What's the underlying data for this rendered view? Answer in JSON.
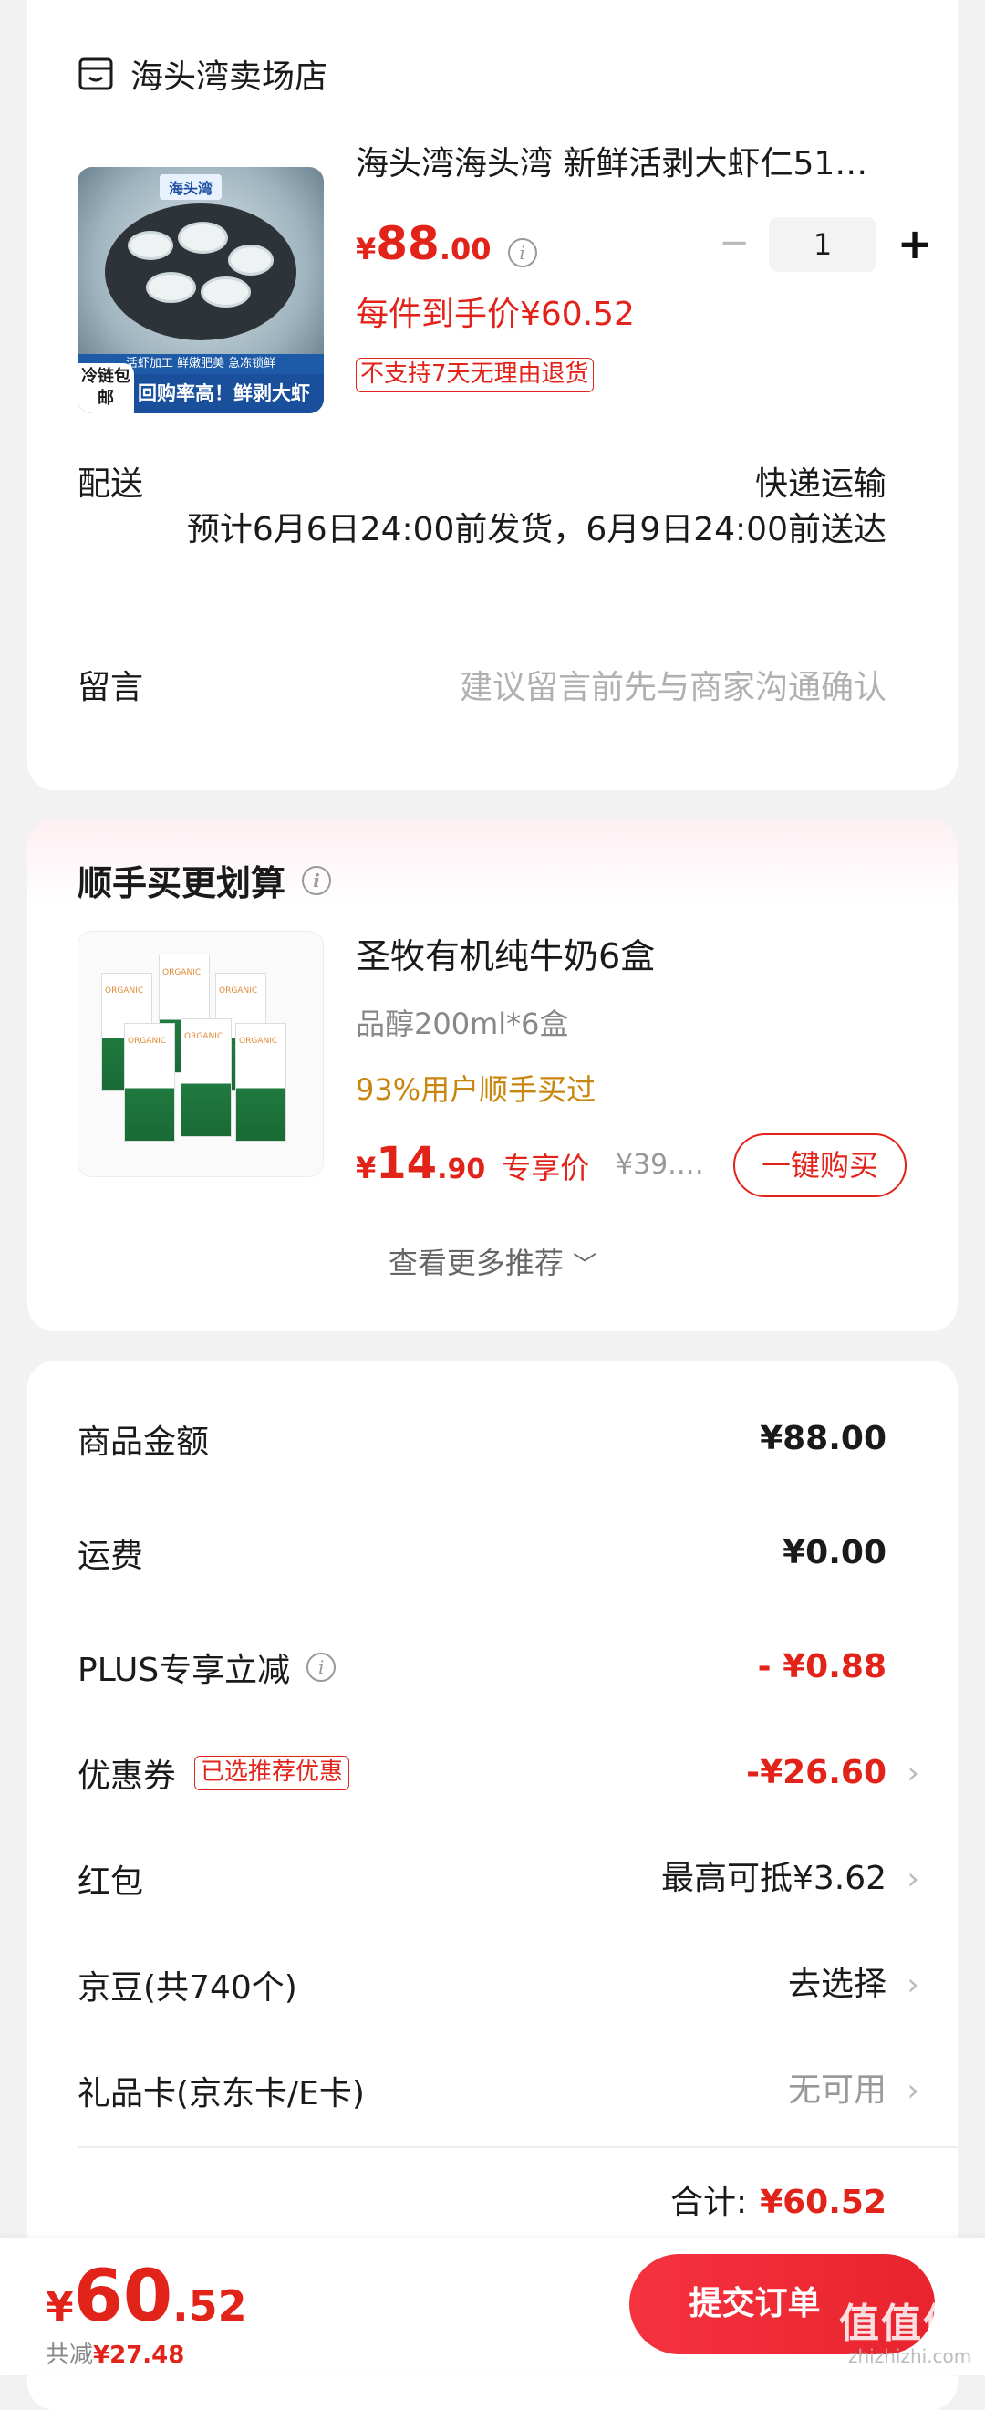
{
  "store": {
    "name": "海头湾卖场店",
    "icon": "store-icon",
    "product": {
      "title": "海头湾海头湾 新鲜活剥大虾仁51…",
      "image_badges": {
        "brand": "海头湾",
        "cold_chain": "冷链包邮",
        "strip_top": "活虾加工 鲜嫩肥美 急冻锁鲜",
        "strip_bottom": "回购率高！鲜剥大虾仁"
      },
      "price_symbol": "¥",
      "price_int": "88",
      "price_dec": ".00",
      "quantity": "1",
      "deal_price": "每件到手价¥60.52",
      "no_return_tag": "不支持7天无理由退货"
    },
    "delivery": {
      "label": "配送",
      "method": "快递运输",
      "eta": "预计6月6日24:00前发货，6月9日24:00前送达"
    },
    "message": {
      "label": "留言",
      "placeholder": "建议留言前先与商家沟通确认"
    }
  },
  "recommend": {
    "title": "顺手买更划算",
    "product": {
      "name": "圣牧有机纯牛奶6盒",
      "spec": "品醇200ml*6盒",
      "social_proof": "93%用户顺手买过",
      "price_symbol": "¥",
      "price_int": "14",
      "price_dec": ".90",
      "price_tag": "专享价",
      "original_price": "¥39.…",
      "buy_label": "一键购买"
    },
    "more_label": "查看更多推荐"
  },
  "summary": {
    "rows": [
      {
        "label": "商品金额",
        "value": "¥88.00"
      },
      {
        "label": "运费",
        "value": "¥0.00"
      },
      {
        "label": "PLUS专享立减",
        "value": "- ¥0.88"
      },
      {
        "label": "优惠券",
        "tag": "已选推荐优惠",
        "value": "-¥26.60"
      },
      {
        "label": "红包",
        "value": "最高可抵¥3.62"
      },
      {
        "label": "京豆(共740个)",
        "value": "去选择"
      },
      {
        "label": "礼品卡(京东卡/E卡)",
        "value": "无可用"
      }
    ],
    "total_label": "合计:",
    "total_value": "¥60.52"
  },
  "bottom": {
    "price_symbol": "¥",
    "price_int": "60",
    "price_dec": ".52",
    "saved_label": "共减",
    "saved_value": "¥27.48",
    "submit_label": "提交订单"
  },
  "watermark": {
    "main": "值值值",
    "sub": "zhizhizhi.com"
  },
  "colors": {
    "accent": "#e2231a",
    "social_proof": "#c8860f",
    "background": "#f2f2f2"
  }
}
